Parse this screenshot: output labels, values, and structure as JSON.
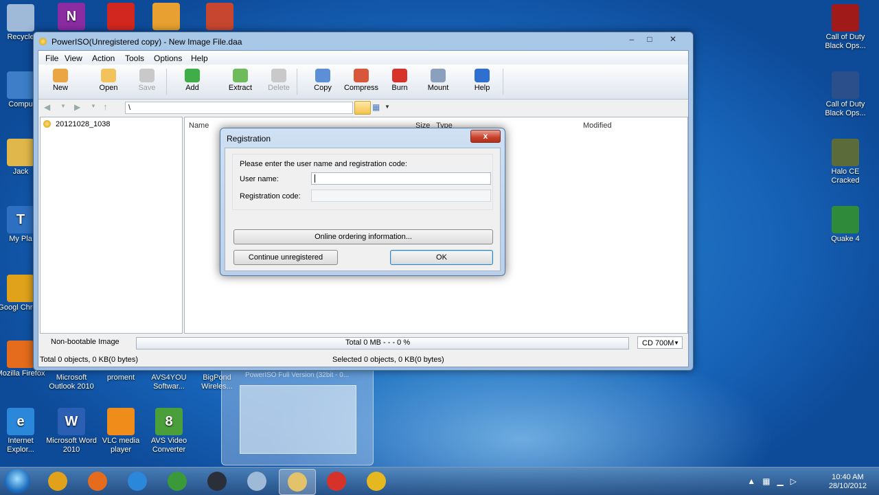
{
  "window": {
    "title": "PowerISO(Unregistered copy) - New Image File.daa",
    "minimize": "‒",
    "maximize": "□",
    "close": "✕"
  },
  "menu": [
    "File",
    "View",
    "Action",
    "Tools",
    "Options",
    "Help"
  ],
  "toolbar": [
    {
      "label": "New",
      "color": "#e9a642"
    },
    {
      "label": "Open",
      "color": "#f1c35a"
    },
    {
      "label": "Save",
      "color": "#c9c9c9",
      "disabled": true
    },
    {
      "label": "Add",
      "color": "#3fae49"
    },
    {
      "label": "Extract",
      "color": "#6dbb5a"
    },
    {
      "label": "Delete",
      "color": "#c9c9c9",
      "disabled": true
    },
    {
      "label": "Copy",
      "color": "#5d8fd6"
    },
    {
      "label": "Compress",
      "color": "#d8573a"
    },
    {
      "label": "Burn",
      "color": "#d6322a"
    },
    {
      "label": "Mount",
      "color": "#8aa0bd"
    },
    {
      "label": "Help",
      "color": "#2f6fd0"
    }
  ],
  "address": "\\",
  "tree_item": "20121028_1038",
  "columns": [
    "Name",
    "Size",
    "Type",
    "Modified"
  ],
  "status": {
    "boot": "Non-bootable Image",
    "total": "Total  0 MB   - - -  0 %",
    "cd": "CD 700M",
    "objects_total": "Total 0 objects, 0 KB(0 bytes)",
    "objects_selected": "Selected 0 objects, 0 KB(0 bytes)"
  },
  "dialog": {
    "title": "Registration",
    "close": "x",
    "prompt": "Please enter the user name and registration code:",
    "username_label": "User name:",
    "username_value": "",
    "code_label": "Registration code:",
    "code_value": "",
    "online_button": "Online ordering information...",
    "continue_button": "Continue unregistered",
    "ok_button": "OK"
  },
  "desktop_left": [
    {
      "label": "Recycle",
      "color": "#9fb9d8",
      "glyph": ""
    },
    {
      "label": "Compu",
      "color": "#3e7ec8",
      "glyph": ""
    },
    {
      "label": "Jack",
      "color": "#e0b74a",
      "glyph": ""
    },
    {
      "label": "My Pla",
      "color": "#2d6fc0",
      "glyph": "T"
    },
    {
      "label": "Googl Chrom",
      "color": "#e0a21a",
      "glyph": ""
    },
    {
      "label": "Mozilla Firefox",
      "color": "#e46c1c",
      "glyph": ""
    },
    {
      "label": "Internet Explor...",
      "color": "#2b87d9",
      "glyph": "e"
    }
  ],
  "desktop_top": [
    {
      "label": "",
      "color": "#8b2ca3",
      "glyph": "N"
    },
    {
      "label": "",
      "color": "#d2271f",
      "glyph": ""
    },
    {
      "label": "",
      "color": "#e8a030",
      "glyph": ""
    },
    {
      "label": "",
      "color": "#c7462f",
      "glyph": ""
    }
  ],
  "desktop_row": [
    {
      "label": "Microsoft Outlook 2010"
    },
    {
      "label": "proment"
    },
    {
      "label": "AVS4YOU Softwar..."
    },
    {
      "label": "BigPond Wireles..."
    }
  ],
  "desktop_bottom": [
    {
      "label": "Microsoft Word 2010",
      "color": "#2b5fb4",
      "glyph": "W"
    },
    {
      "label": "VLC media player",
      "color": "#f08c1a",
      "glyph": ""
    },
    {
      "label": "AVS Video Converter",
      "color": "#4a9f3a",
      "glyph": "8"
    }
  ],
  "desktop_right": [
    {
      "label": "Call of Duty Black Ops...",
      "color": "#a11a1a",
      "glyph": ""
    },
    {
      "label": "Call of Duty Black Ops...",
      "color": "#2a4f8a",
      "glyph": ""
    },
    {
      "label": "Halo CE Cracked",
      "color": "#5c6b3a",
      "glyph": ""
    },
    {
      "label": "Quake 4",
      "color": "#2f8a3a",
      "glyph": ""
    }
  ],
  "preview_title": "PowerISO Full Version (32bit - 0...",
  "taskbar": {
    "apps": [
      {
        "name": "chrome",
        "color": "#e0a21a"
      },
      {
        "name": "firefox",
        "color": "#e46c1c"
      },
      {
        "name": "ie",
        "color": "#2b87d9"
      },
      {
        "name": "utorrent",
        "color": "#3a9a3a"
      },
      {
        "name": "steam",
        "color": "#2a2f3a"
      },
      {
        "name": "generic",
        "color": "#9fb9d8"
      },
      {
        "name": "explorer",
        "color": "#e2c36a"
      },
      {
        "name": "record",
        "color": "#d6322a"
      },
      {
        "name": "poweriso",
        "color": "#e6b820"
      }
    ],
    "time": "10:40 AM",
    "date": "28/10/2012"
  }
}
